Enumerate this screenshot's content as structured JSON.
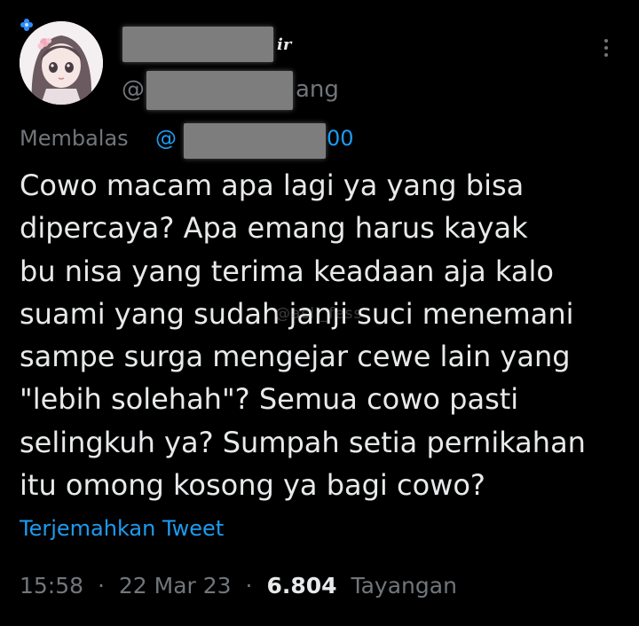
{
  "author": {
    "name_visible_suffix": "ir",
    "handle_prefix": "@",
    "handle_visible_suffix": "ang",
    "avatar": "anime-girl-avatar",
    "badge_icon": "flower-icon"
  },
  "reply": {
    "label": "Membalas",
    "at": "@",
    "handle_visible_suffix": "00"
  },
  "tweet": {
    "lines": [
      "Cowo macam apa lagi ya yang bisa",
      "dipercaya? Apa emang harus kayak",
      "bu nisa yang terima keadaan aja kalo",
      "suami yang sudah janji suci menemani",
      "sampe surga mengejar cewe lain yang",
      "\"lebih solehah\"? Semua cowo pasti",
      "selingkuh ya? Sumpah setia pernikahan",
      "itu omong kosong ya bagi cowo?"
    ],
    "translate_label": "Terjemahkan Tweet"
  },
  "meta": {
    "time": "15:58",
    "separator": "·",
    "date": "22 Mar 23",
    "views_count": "6.804",
    "views_label": "Tayangan"
  },
  "watermark": "@asli_fess",
  "colors": {
    "background": "#000000",
    "text": "#e7e9ea",
    "secondary": "#71767b",
    "link": "#1d9bf0"
  }
}
